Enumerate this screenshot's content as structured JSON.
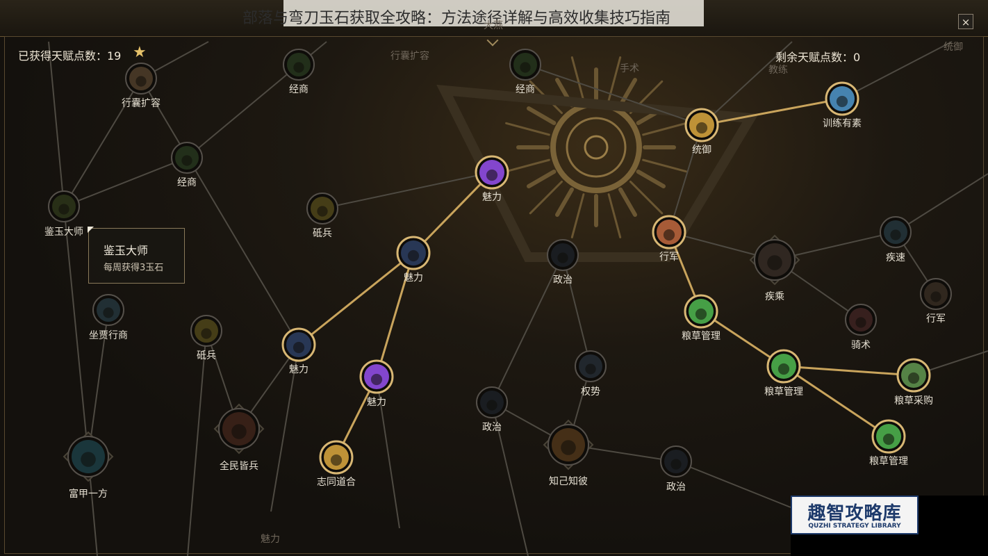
{
  "title": "部落与弯刀玉石获取全攻略：方法途径详解与高效收集技巧指南",
  "close_label": "×",
  "stats": {
    "earned_label": "已获得天赋点数：19",
    "remaining_label": "剩余天赋点数：0"
  },
  "tooltip": {
    "title": "鉴玉大师",
    "desc": "每周获得3玉石"
  },
  "faded_labels": [
    "大燕",
    "行囊扩容",
    "手术",
    "教练",
    "统御",
    "魅力"
  ],
  "nodes": [
    {
      "label": "行囊扩容",
      "state": "inactive",
      "color": "#8a6a4a"
    },
    {
      "label": "经商",
      "state": "inactive",
      "color": "#3c5a30"
    },
    {
      "label": "经商",
      "state": "inactive",
      "color": "#3c5a30"
    },
    {
      "label": "经商",
      "state": "inactive",
      "color": "#3c5a30"
    },
    {
      "label": "统御",
      "state": "active",
      "color": "#c89a3a"
    },
    {
      "label": "训练有素",
      "state": "active",
      "color": "#4a8ab8"
    },
    {
      "label": "鉴玉大师",
      "state": "inactive",
      "color": "#4a5a2a"
    },
    {
      "label": "砥兵",
      "state": "inactive",
      "color": "#8a7a2a"
    },
    {
      "label": "魅力",
      "state": "active",
      "color": "#8a4ad8"
    },
    {
      "label": "魅力",
      "state": "active",
      "color": "#2a3a5a"
    },
    {
      "label": "政治",
      "state": "inactive",
      "color": "#2a3440"
    },
    {
      "label": "行军",
      "state": "active",
      "color": "#b0603a"
    },
    {
      "label": "疾乘",
      "state": "inactive",
      "color": "#5a4a40"
    },
    {
      "label": "疾速",
      "state": "inactive",
      "color": "#3a5a6a"
    },
    {
      "label": "坐贾行商",
      "state": "inactive",
      "color": "#3a5a6a"
    },
    {
      "label": "行军",
      "state": "inactive",
      "color": "#5a4a3a"
    },
    {
      "label": "粮草管理",
      "state": "active",
      "color": "#4aa84a"
    },
    {
      "label": "骑术",
      "state": "inactive",
      "color": "#6a3a3a"
    },
    {
      "label": "砥兵",
      "state": "inactive",
      "color": "#8a7a2a"
    },
    {
      "label": "魅力",
      "state": "active",
      "color": "#2a3a5a"
    },
    {
      "label": "权势",
      "state": "inactive",
      "color": "#3a4a5a"
    },
    {
      "label": "粮草管理",
      "state": "active",
      "color": "#4aa84a"
    },
    {
      "label": "粮草采购",
      "state": "active",
      "color": "#5a8a4a"
    },
    {
      "label": "魅力",
      "state": "active",
      "color": "#8a4ad8"
    },
    {
      "label": "政治",
      "state": "inactive",
      "color": "#2a3440"
    },
    {
      "label": "全民皆兵",
      "state": "inactive",
      "color": "#6a3a2a"
    },
    {
      "label": "粮草管理",
      "state": "active",
      "color": "#4aa84a"
    },
    {
      "label": "志同道合",
      "state": "active",
      "color": "#c89a3a"
    },
    {
      "label": "知己知彼",
      "state": "inactive",
      "color": "#8a5a2a"
    },
    {
      "label": "政治",
      "state": "inactive",
      "color": "#2a3440"
    },
    {
      "label": "富甲一方",
      "state": "inactive",
      "color": "#2a6a7a"
    }
  ],
  "colors": {
    "active_link": "#c9a45c",
    "inactive_link": "#4e4a42",
    "active_ring": "#d8b774",
    "inactive_ring": "#55504a"
  },
  "watermark": {
    "title": "趣智攻略库",
    "sub": "QUZHI STRATEGY LIBRARY"
  }
}
